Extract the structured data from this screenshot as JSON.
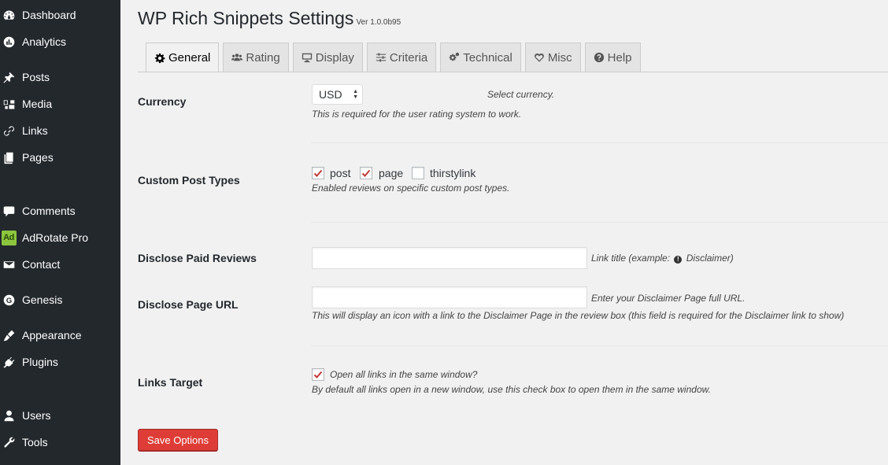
{
  "sidebar": {
    "items": [
      {
        "label": "Dashboard",
        "icon": "dashboard-icon"
      },
      {
        "label": "Analytics",
        "icon": "analytics-icon"
      },
      {
        "label": "Posts",
        "icon": "pushpin-icon"
      },
      {
        "label": "Media",
        "icon": "media-icon"
      },
      {
        "label": "Links",
        "icon": "link-icon"
      },
      {
        "label": "Pages",
        "icon": "pages-icon"
      },
      {
        "label": "Comments",
        "icon": "comment-icon"
      },
      {
        "label": "AdRotate Pro",
        "icon": "adrotate-icon",
        "badge": "Ad"
      },
      {
        "label": "Contact",
        "icon": "envelope-icon"
      },
      {
        "label": "Genesis",
        "icon": "genesis-icon",
        "badge": "G"
      },
      {
        "label": "Appearance",
        "icon": "paintbrush-icon"
      },
      {
        "label": "Plugins",
        "icon": "plugin-icon"
      },
      {
        "label": "Users",
        "icon": "user-icon"
      },
      {
        "label": "Tools",
        "icon": "wrench-icon"
      }
    ]
  },
  "header": {
    "title": "WP Rich Snippets Settings",
    "version": "Ver 1.0.0b95"
  },
  "tabs": [
    {
      "label": "General",
      "icon": "gear-icon",
      "active": true
    },
    {
      "label": "Rating",
      "icon": "users-icon",
      "active": false
    },
    {
      "label": "Display",
      "icon": "monitor-icon",
      "active": false
    },
    {
      "label": "Criteria",
      "icon": "sliders-icon",
      "active": false
    },
    {
      "label": "Technical",
      "icon": "gears-icon",
      "active": false
    },
    {
      "label": "Misc",
      "icon": "heart-icon",
      "active": false
    },
    {
      "label": "Help",
      "icon": "help-icon",
      "active": false
    }
  ],
  "currency": {
    "label": "Currency",
    "selected": "USD",
    "hint": "Select currency.",
    "description": "This is required for the user rating system to work."
  },
  "custom_post_types": {
    "label": "Custom Post Types",
    "options": [
      {
        "label": "post",
        "checked": true
      },
      {
        "label": "page",
        "checked": true
      },
      {
        "label": "thirstylink",
        "checked": false
      }
    ],
    "description": "Enabled reviews on specific custom post types."
  },
  "disclose_paid_reviews": {
    "label": "Disclose Paid Reviews",
    "value": "",
    "hint_prefix": "Link title (example:",
    "hint_suffix": "Disclaimer)",
    "info_glyph": "!"
  },
  "disclose_page_url": {
    "label": "Disclose Page URL",
    "value": "",
    "hint": "Enter your Disclaimer Page full URL.",
    "description": "This will display an icon with a link to the Disclaimer Page in the review box (this field is required for the Disclaimer link to show)"
  },
  "links_target": {
    "label": "Links Target",
    "checked": true,
    "option_label": "Open all links in the same window?",
    "description": "By default all links open in a new window, use this check box to open them in the same window."
  },
  "actions": {
    "save_label": "Save Options"
  },
  "colors": {
    "sidebar_bg": "#23282d",
    "save_button": "#dd3d36",
    "check_mark": "#c03a35"
  }
}
